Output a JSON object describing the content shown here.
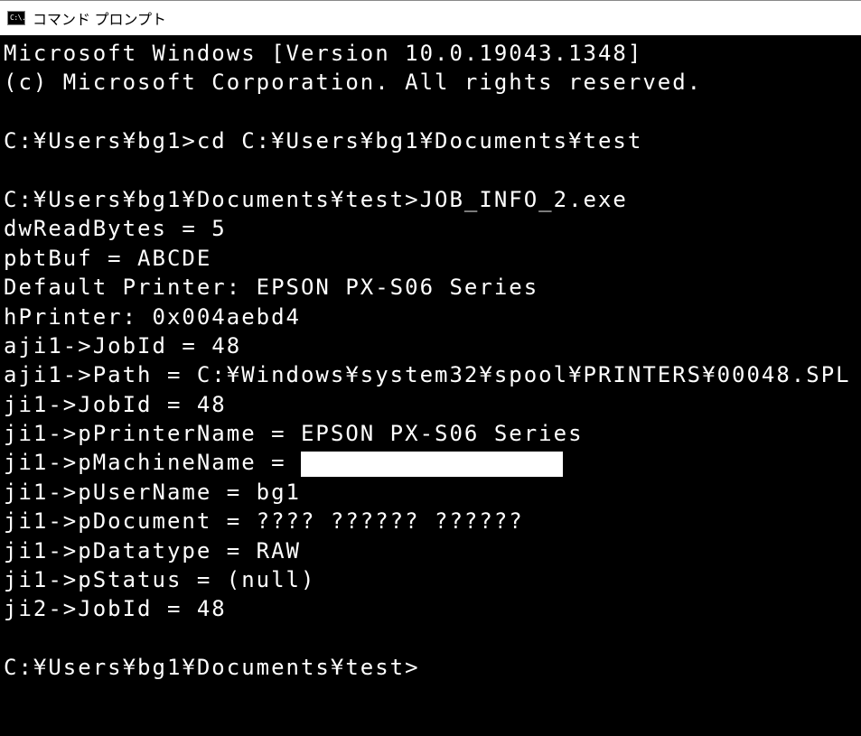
{
  "window": {
    "title": "コマンド プロンプト",
    "icon_text": "C:\\."
  },
  "terminal": {
    "header1": "Microsoft Windows [Version 10.0.19043.1348]",
    "header2": "(c) Microsoft Corporation. All rights reserved.",
    "blank": " ",
    "prompt1": "C:¥Users¥bg1>",
    "cmd1": "cd C:¥Users¥bg1¥Documents¥test",
    "prompt2": "C:¥Users¥bg1¥Documents¥test>",
    "cmd2": "JOB_INFO_2.exe",
    "out_dwReadBytes": "dwReadBytes = 5",
    "out_pbtBuf": "pbtBuf = ABCDE",
    "out_defaultPrinter": "Default Printer: EPSON PX-S06 Series",
    "out_hPrinter": "hPrinter: 0x004aebd4",
    "out_aji1_JobId": "aji1->JobId = 48",
    "out_aji1_Path": "aji1->Path = C:¥Windows¥system32¥spool¥PRINTERS¥00048.SPL",
    "out_ji1_JobId": "ji1->JobId = 48",
    "out_ji1_pPrinterName": "ji1->pPrinterName = EPSON PX-S06 Series",
    "out_ji1_pMachineName_prefix": "ji1->pMachineName = ",
    "out_ji1_pUserName": "ji1->pUserName = bg1",
    "out_ji1_pDocument": "ji1->pDocument = ???? ?????? ??????",
    "out_ji1_pDatatype": "ji1->pDatatype = RAW",
    "out_ji1_pStatus": "ji1->pStatus = (null)",
    "out_ji2_JobId": "ji2->JobId = 48",
    "prompt3": "C:¥Users¥bg1¥Documents¥test>"
  }
}
